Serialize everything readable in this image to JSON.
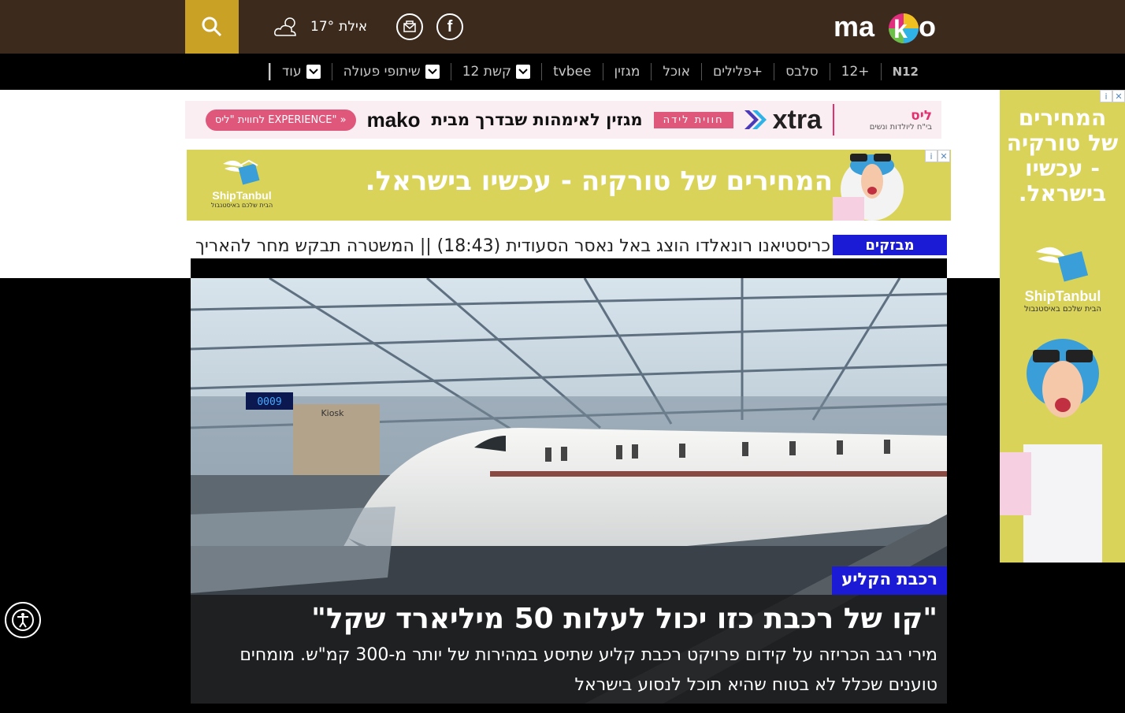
{
  "header": {
    "weather_city": "אילת",
    "weather_temp": "17°",
    "logo_text": "mako"
  },
  "nav": {
    "items": [
      {
        "label": "N12",
        "dropdown": false
      },
      {
        "label": "12+",
        "dropdown": false
      },
      {
        "label": "סלבס",
        "dropdown": false
      },
      {
        "label": "פלילים+",
        "dropdown": false
      },
      {
        "label": "אוכל",
        "dropdown": false
      },
      {
        "label": "מגזין",
        "dropdown": false
      },
      {
        "label": "tvbee",
        "dropdown": false
      },
      {
        "label": "קשת 12",
        "dropdown": true
      },
      {
        "label": "שיתופי פעולה",
        "dropdown": true
      },
      {
        "label": "עוד",
        "dropdown": true
      }
    ]
  },
  "strip_ad": {
    "brand": "ליס",
    "brand_sub": "בי\"ח ליולדות ונשים",
    "xtra": "xtra",
    "pill": "חווית לידה",
    "text": "מגזין לאימהות שבדרך מבית",
    "mako": "mako",
    "cta": "לחווית \"ליס EXPERIENCE\""
  },
  "banner_ad": {
    "text": "המחירים של טורקיה - עכשיו בישראל.",
    "brand": "ShipTanbul",
    "brand_sub": "הבית שלכם באיסטנבול"
  },
  "ticker": {
    "label": "מבזקים",
    "text": "כריסטיאנו רונאלדו הוצג באל נאסר הסעודית (18:43) || המשטרה תבקש מחר להאריך את מעצרה"
  },
  "hero": {
    "tag": "רכבת הקליע",
    "title": "\"קו של רכבת כזו יכול לעלות 50 מיליארד שקל\"",
    "subtitle": "מירי רגב הכריזה על קידום פרויקט רכבת קליע שתיסע במהירות של יותר מ-300 קמ\"ש. מומחים טוענים שכלל לא בטוח שהיא תוכל לנסוע בישראל",
    "platform_sign": "0009",
    "kiosk": "Kiosk"
  },
  "side_ad": {
    "text": "המחירים של טורקיה - עכשיו בישראל.",
    "brand": "ShipTanbul",
    "brand_sub": "הבית שלכם באיסטנבול"
  },
  "colors": {
    "header_bg": "#3c2a1d",
    "search_bg": "#c9a225",
    "accent_blue": "#1b1bd6",
    "ad_yellow": "#d9d35a"
  }
}
